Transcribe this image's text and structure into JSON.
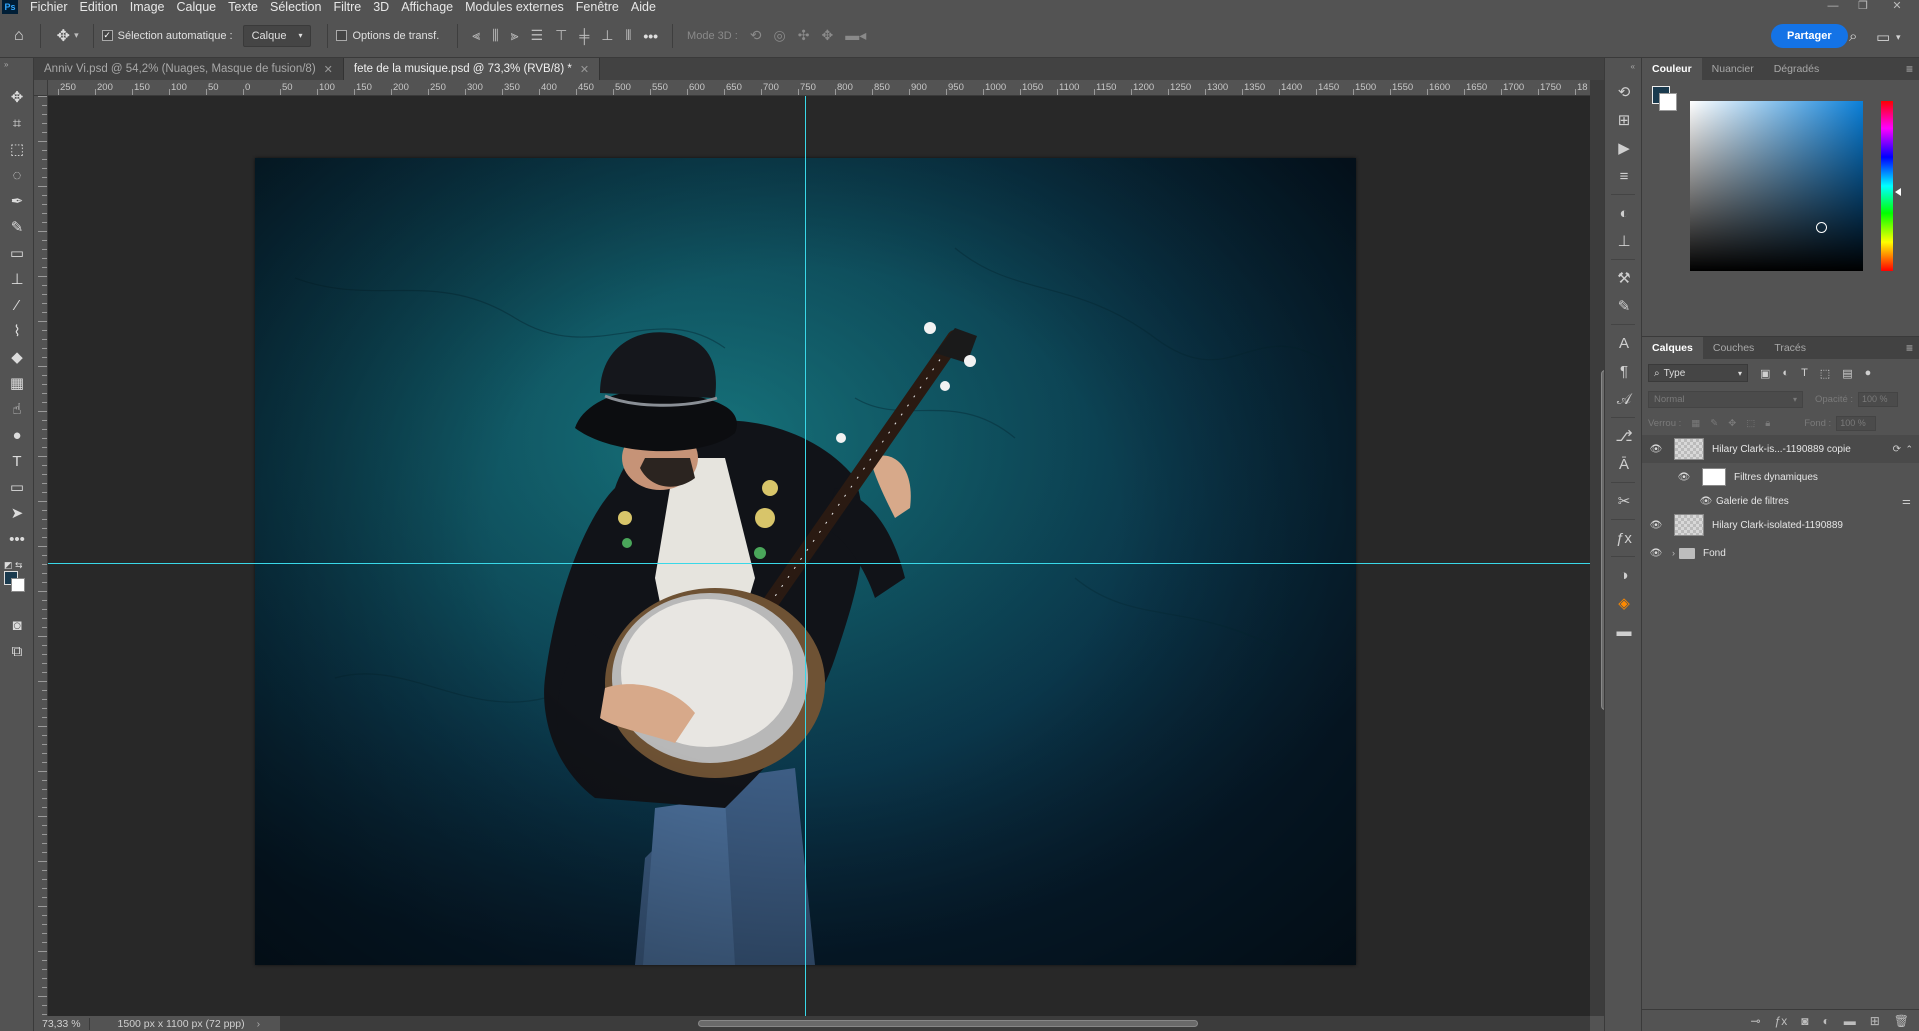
{
  "menubar": {
    "logo": "Ps",
    "items": [
      "Fichier",
      "Edition",
      "Image",
      "Calque",
      "Texte",
      "Sélection",
      "Filtre",
      "3D",
      "Affichage",
      "Modules externes",
      "Fenêtre",
      "Aide"
    ],
    "window_controls": [
      "—",
      "❐",
      "✕"
    ]
  },
  "options": {
    "home_icon": "home-icon",
    "move_icon": "move-tool-icon",
    "auto_select_label": "Sélection automatique :",
    "auto_select_checked": true,
    "auto_select_target": "Calque",
    "transform_label": "Options de transf.",
    "more": "•••",
    "mode3d_label": "Mode 3D :",
    "share_label": "Partager"
  },
  "tabs": [
    {
      "label": "Anniv Vi.psd @ 54,2% (Nuages, Masque de fusion/8)",
      "active": false
    },
    {
      "label": "fete de la musique.psd @ 73,3% (RVB/8) *",
      "active": true
    }
  ],
  "ruler": {
    "h_labels": [
      "250",
      "200",
      "150",
      "100",
      "50",
      "0",
      "50",
      "100",
      "150",
      "200",
      "250",
      "300",
      "350",
      "400",
      "450",
      "500",
      "550",
      "600",
      "650",
      "700",
      "750",
      "800",
      "850",
      "900",
      "950",
      "1000",
      "1050",
      "1100",
      "1150",
      "1200",
      "1250",
      "1300",
      "1350",
      "1400",
      "1450",
      "1500",
      "1550",
      "1600",
      "1650",
      "1700",
      "1750",
      "18"
    ]
  },
  "status": {
    "zoom": "73,33 %",
    "doc_info": "1500 px x 1100 px (72 ppp)"
  },
  "color_panel": {
    "tabs": [
      "Couleur",
      "Nuancier",
      "Dégradés"
    ],
    "foreground": "#1a3a4e",
    "background": "#ffffff"
  },
  "layers_panel": {
    "tabs": [
      "Calques",
      "Couches",
      "Tracés"
    ],
    "filter_label": "Type",
    "blend_mode": "Normal",
    "opacity_label": "Opacité :",
    "opacity_value": "100 %",
    "lock_label": "Verrou :",
    "fill_label": "Fond :",
    "fill_value": "100 %",
    "layers": [
      {
        "name": "Hilary Clark-is...-1190889 copie",
        "type": "smart",
        "selected": true
      },
      {
        "name": "Filtres dynamiques",
        "type": "smart-filter-mask"
      },
      {
        "name": "Galerie de filtres",
        "type": "filter"
      },
      {
        "name": "Hilary Clark-isolated-1190889",
        "type": "smart"
      },
      {
        "name": "Fond",
        "type": "group"
      }
    ]
  },
  "canvas": {
    "guide_color": "#39d8e8",
    "background_color": "#0d4a58"
  }
}
